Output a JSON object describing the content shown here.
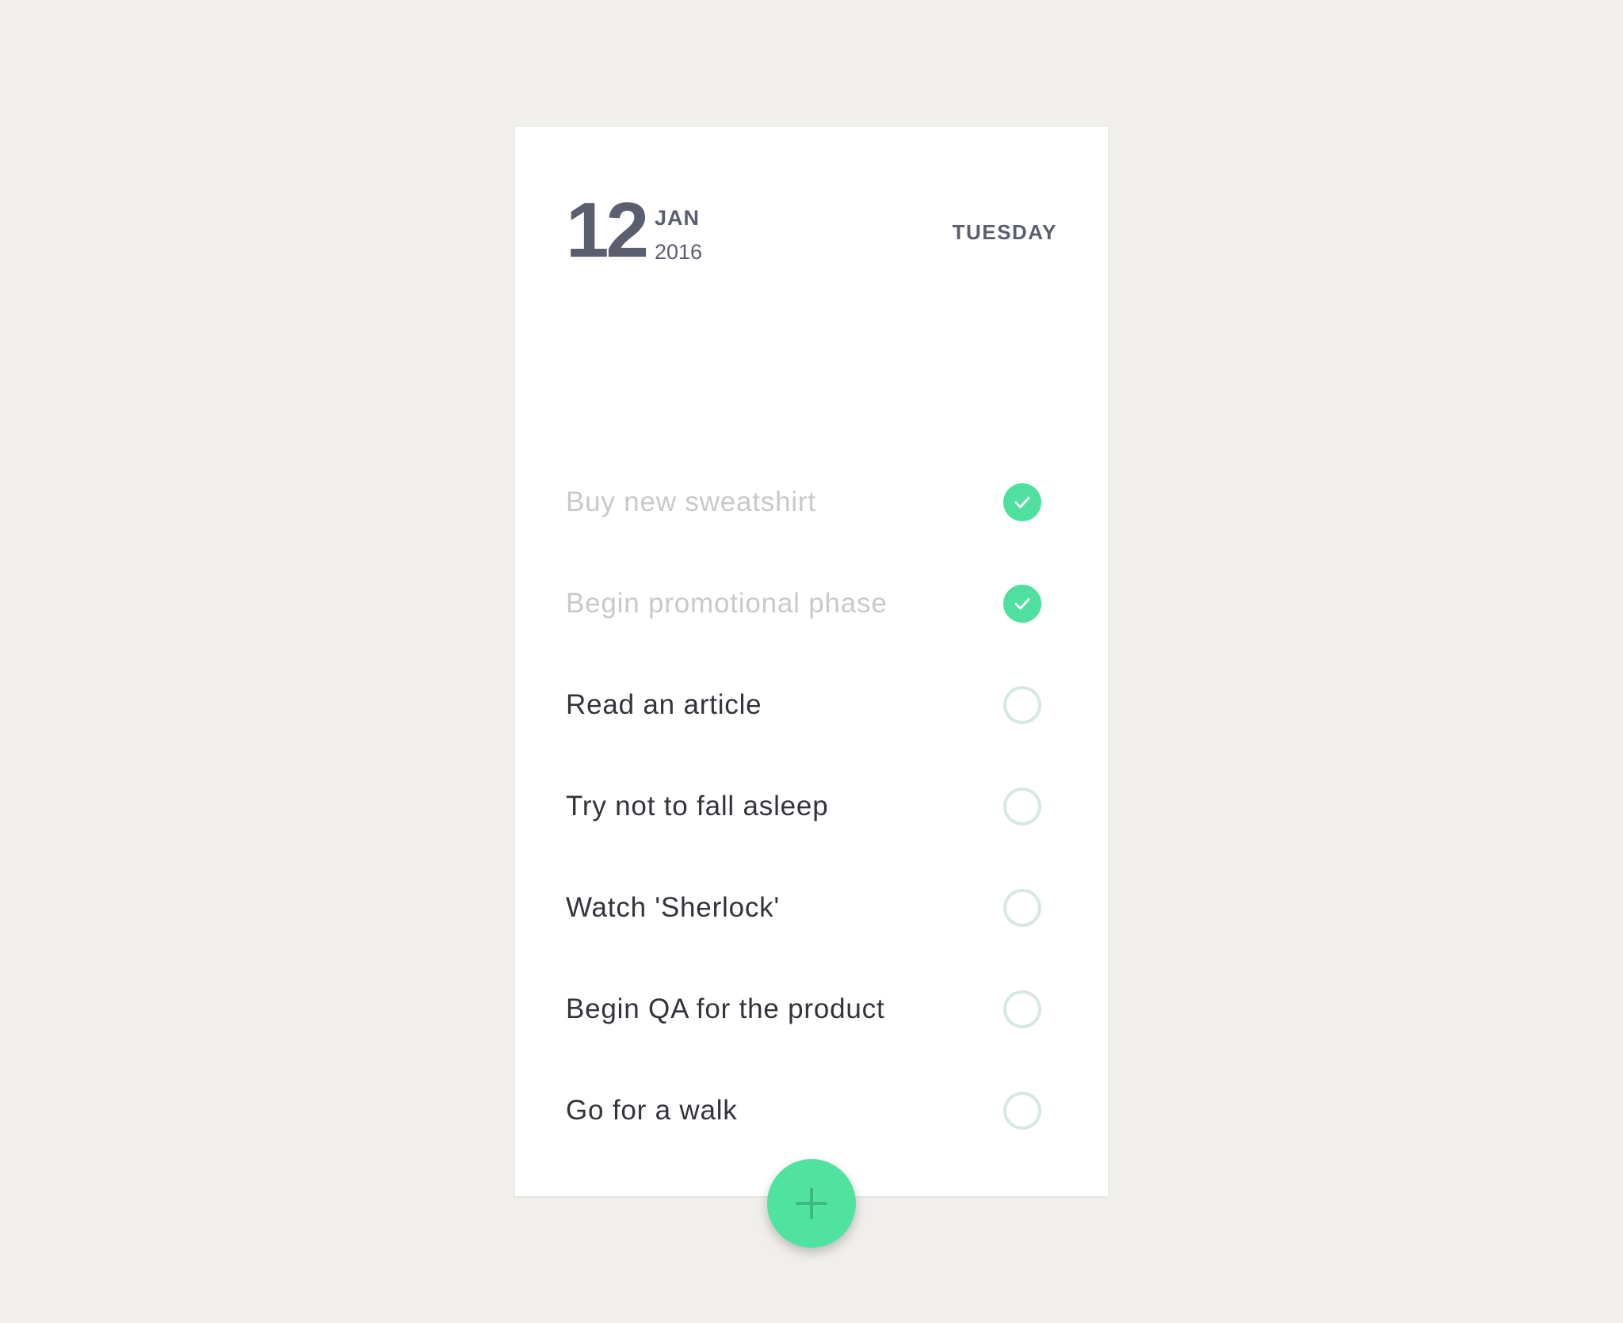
{
  "header": {
    "day": "12",
    "month": "JAN",
    "year": "2016",
    "weekday": "TUESDAY"
  },
  "tasks": [
    {
      "label": "Buy new sweatshirt",
      "done": true
    },
    {
      "label": "Begin promotional phase",
      "done": true
    },
    {
      "label": "Read an article",
      "done": false
    },
    {
      "label": "Try not to fall asleep",
      "done": false
    },
    {
      "label": "Watch 'Sherlock'",
      "done": false
    },
    {
      "label": "Begin QA for the product",
      "done": false
    },
    {
      "label": "Go for a walk",
      "done": false
    }
  ],
  "colors": {
    "background": "#f0efeb",
    "card": "#ffffff",
    "accent": "#50e3a0",
    "text": "#33343b",
    "muted_text": "#c8c9cc",
    "header_text": "#5b5e6e",
    "unchecked_ring": "#d7e8e3"
  },
  "icons": {
    "check": "check-icon",
    "add": "plus-icon"
  }
}
